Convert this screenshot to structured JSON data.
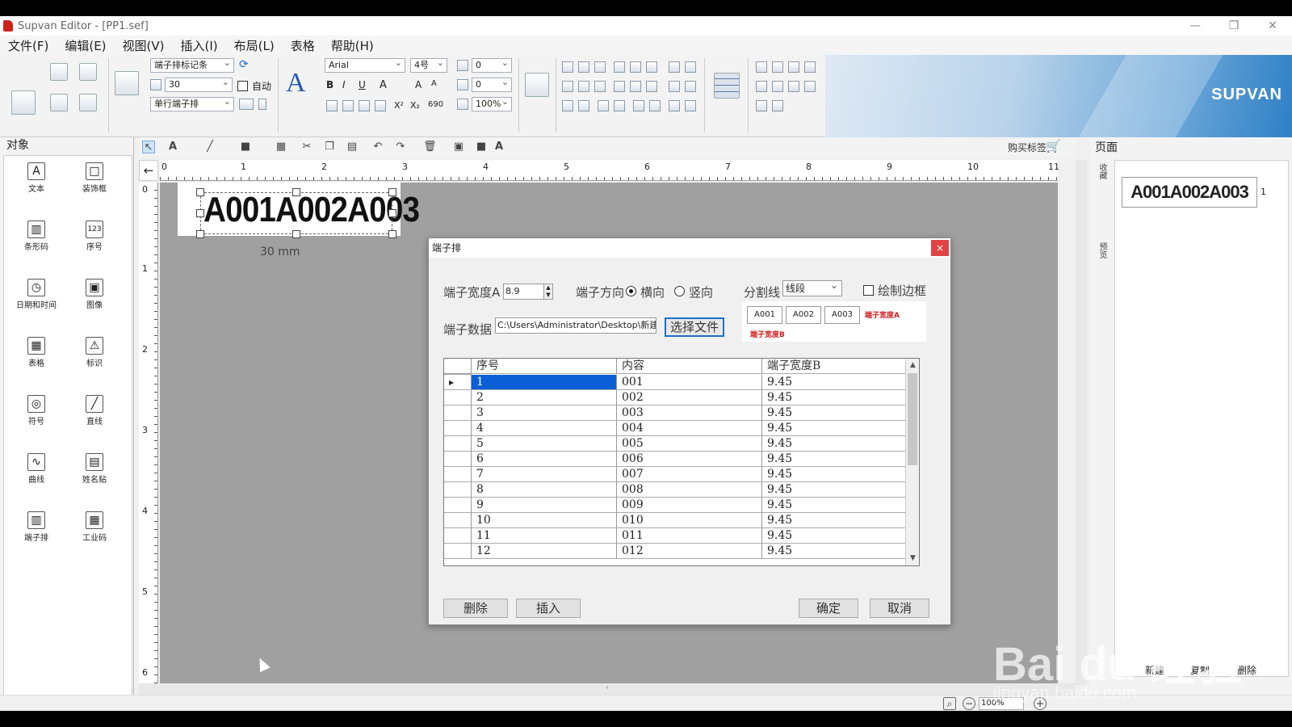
{
  "window": {
    "title": "Supvan Editor - [PP1.sef]",
    "minimize": "—",
    "restore": "❐",
    "close": "✕"
  },
  "menu": [
    "文件(F)",
    "编辑(E)",
    "视图(V)",
    "插入(I)",
    "布局(L)",
    "表格",
    "帮助(H)"
  ],
  "ribbon": {
    "record_select": "端子排标记条",
    "size_value": "30",
    "auto_label": "自动",
    "layout_select": "单行端子排",
    "font_select": "Arial",
    "fontsize_select": "4号",
    "spacing1": "0",
    "spacing2": "0",
    "scale_select": "100%",
    "brand": "SUPVAN"
  },
  "objects_panel": {
    "title": "对象",
    "items": [
      {
        "label": "文本",
        "icon": "A"
      },
      {
        "label": "装饰框",
        "icon": "□"
      },
      {
        "label": "条形码",
        "icon": "▥"
      },
      {
        "label": "序号",
        "icon": "123"
      },
      {
        "label": "日期和时间",
        "icon": "◷"
      },
      {
        "label": "图像",
        "icon": "▣"
      },
      {
        "label": "表格",
        "icon": "▦"
      },
      {
        "label": "标识",
        "icon": "⚠"
      },
      {
        "label": "符号",
        "icon": "◎"
      },
      {
        "label": "直线",
        "icon": "╱"
      },
      {
        "label": "曲线",
        "icon": "∿"
      },
      {
        "label": "姓名贴",
        "icon": "▤"
      },
      {
        "label": "端子排",
        "icon": "▥"
      },
      {
        "label": "工业码",
        "icon": "▦"
      }
    ]
  },
  "toolbar": {
    "buy_label": "购买标签"
  },
  "ruler": {
    "h": [
      "0",
      "1",
      "2",
      "3",
      "4",
      "5",
      "6",
      "7",
      "8",
      "9",
      "10",
      "11"
    ],
    "v": [
      "0",
      "1",
      "2",
      "3",
      "4",
      "5",
      "6"
    ]
  },
  "canvas": {
    "label_text": "A001A002A003",
    "size_label": "30 mm"
  },
  "pages_panel": {
    "title": "页面",
    "side_tab_1": "收藏",
    "side_tab_2": "预览",
    "thumb_text": "A001A002A003",
    "thumb_num": "1",
    "new_btn": "新建",
    "copy_btn": "复制",
    "delete_btn": "删除"
  },
  "status": {
    "zoom": "100%"
  },
  "dialog": {
    "title": "端子排",
    "close": "×",
    "width_a_label": "端子宽度A",
    "width_a_value": "8.9",
    "direction_label": "端子方向",
    "horizontal": "横向",
    "vertical": "竖向",
    "divider_label": "分割线",
    "divider_value": "线段",
    "border_label": "绘制边框",
    "data_label": "端子数据",
    "data_path": "C:\\Users\\Administrator\\Desktop\\新建文",
    "select_file": "选择文件",
    "preview": {
      "cells": [
        "A001",
        "A002",
        "A003"
      ],
      "width_a": "端子宽度A",
      "width_b": "端子宽度B"
    },
    "columns": [
      "序号",
      "内容",
      "端子宽度B"
    ],
    "rows": [
      [
        "1",
        "001",
        "9.45"
      ],
      [
        "2",
        "002",
        "9.45"
      ],
      [
        "3",
        "003",
        "9.45"
      ],
      [
        "4",
        "004",
        "9.45"
      ],
      [
        "5",
        "005",
        "9.45"
      ],
      [
        "6",
        "006",
        "9.45"
      ],
      [
        "7",
        "007",
        "9.45"
      ],
      [
        "8",
        "008",
        "9.45"
      ],
      [
        "9",
        "009",
        "9.45"
      ],
      [
        "10",
        "010",
        "9.45"
      ],
      [
        "11",
        "011",
        "9.45"
      ],
      [
        "12",
        "012",
        "9.45"
      ]
    ],
    "delete_btn": "删除",
    "insert_btn": "插入",
    "ok_btn": "确定",
    "cancel_btn": "取消"
  },
  "watermark": {
    "main": "Bai du 经验",
    "sub": "jingyan.baidu.com"
  }
}
